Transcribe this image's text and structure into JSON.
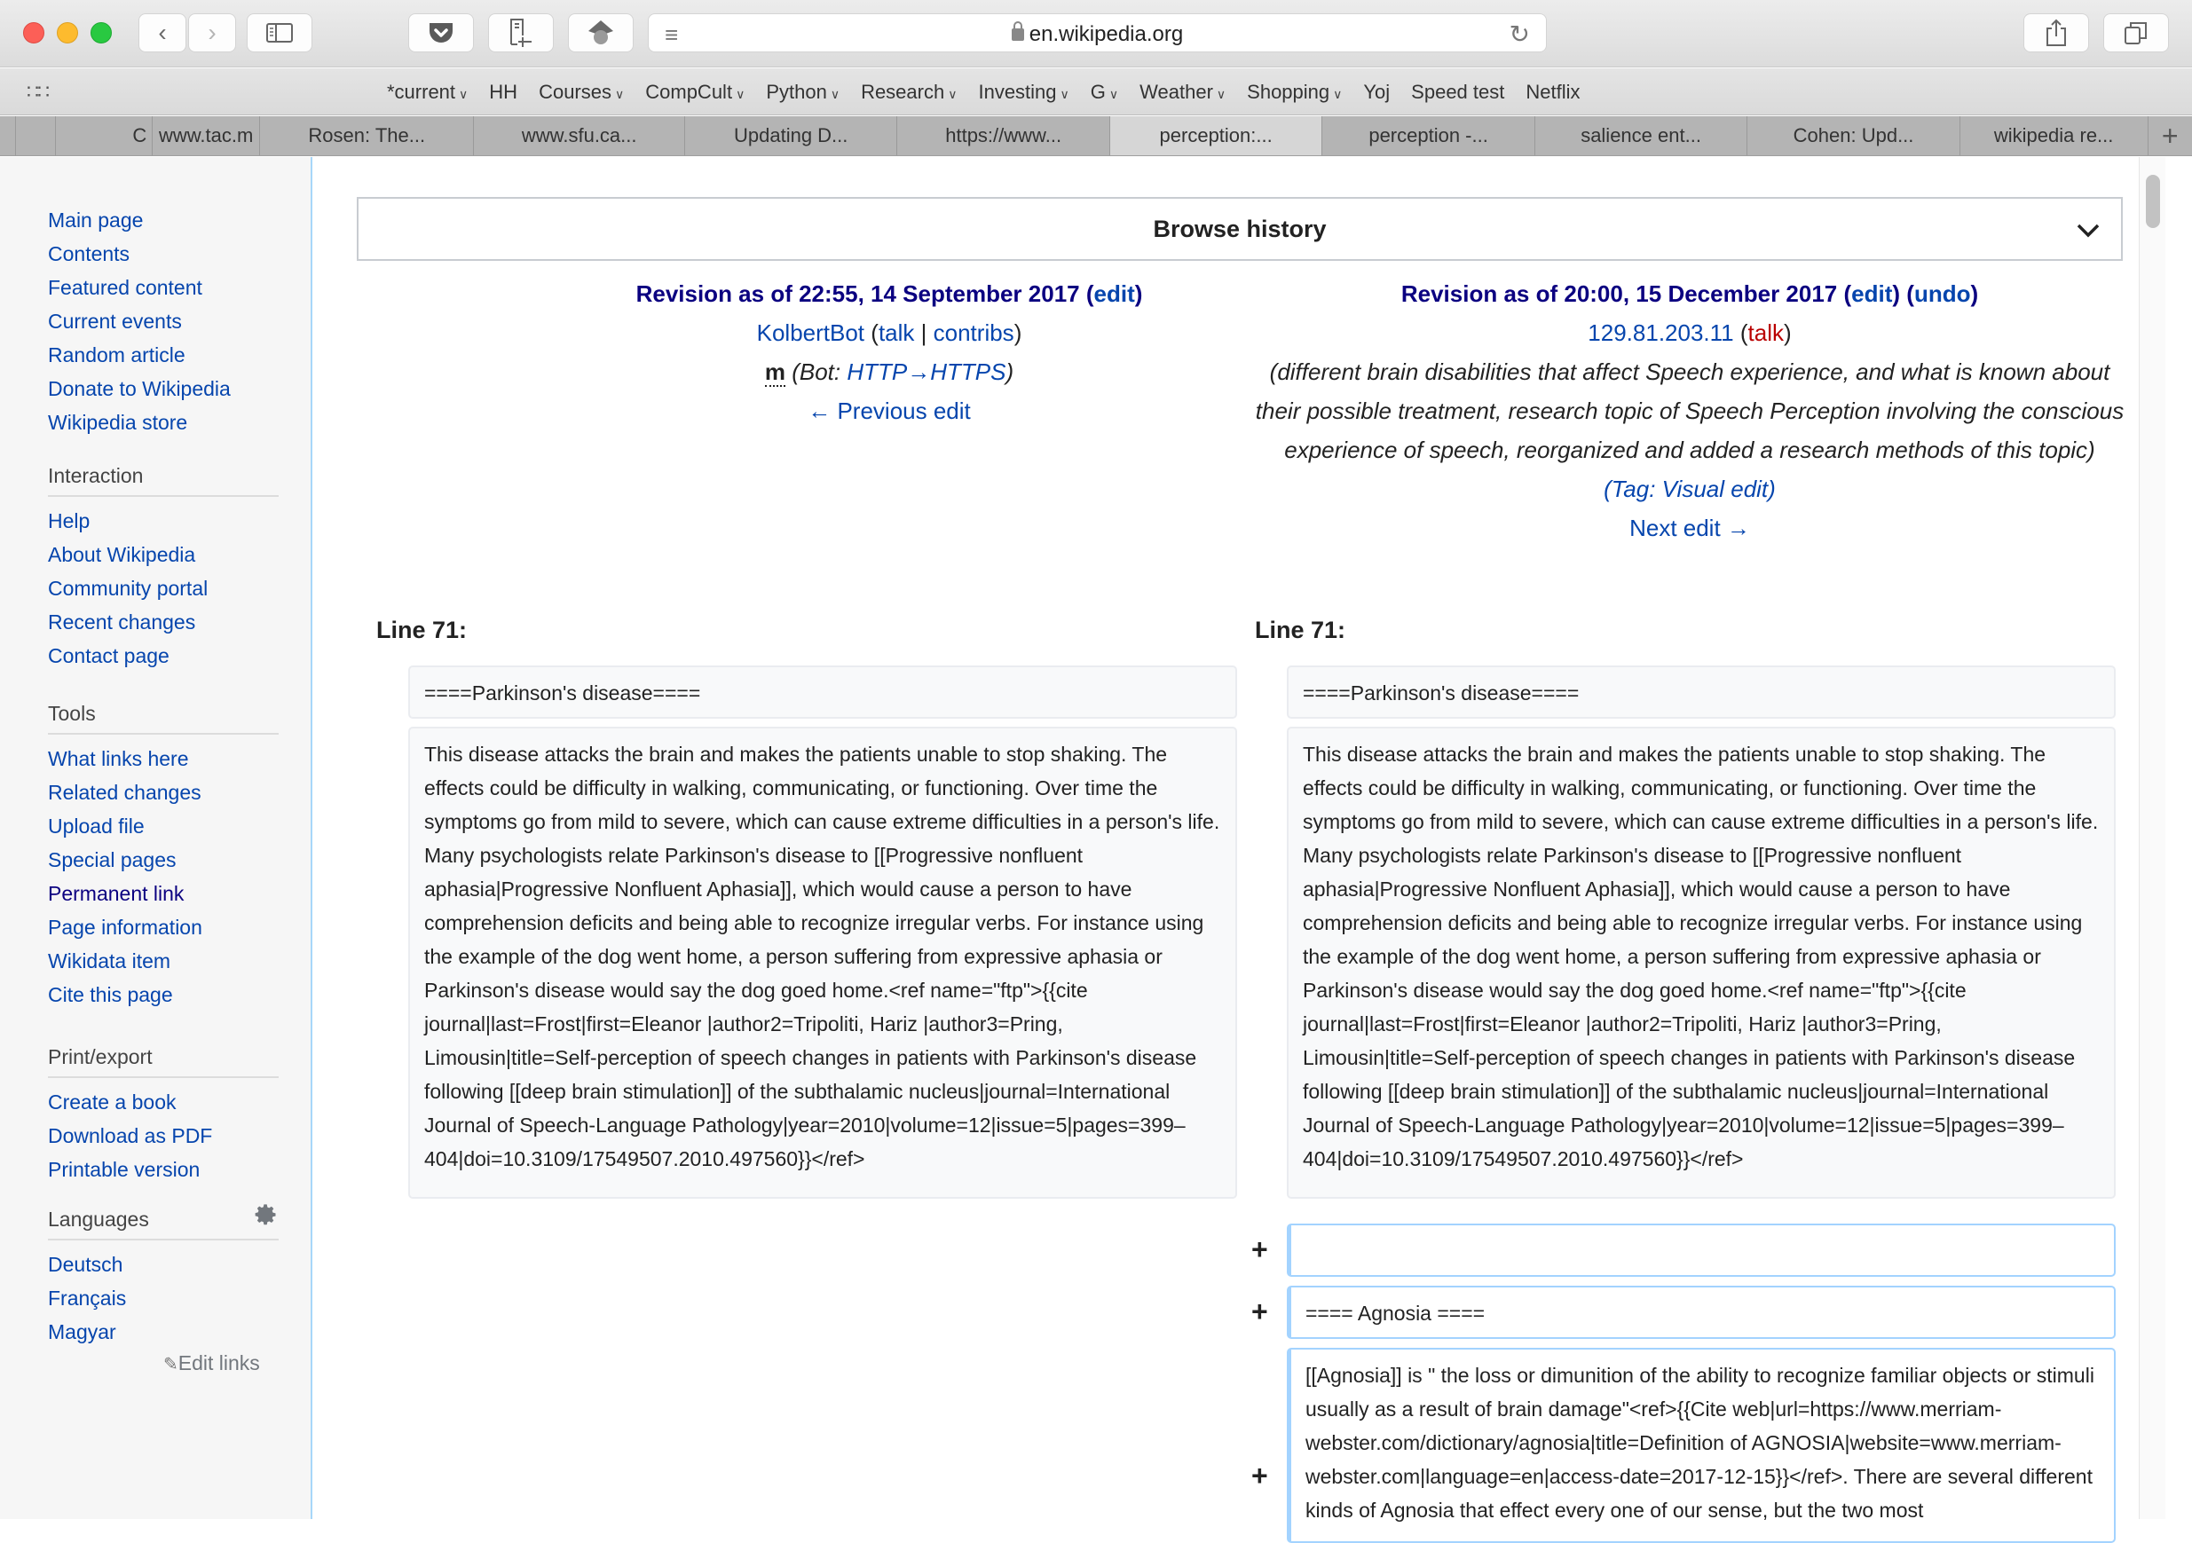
{
  "browser": {
    "url_host": "en.wikipedia.org",
    "toolbar_icons": [
      "back-icon",
      "forward-icon",
      "sidebar-icon",
      "pocket-icon",
      "add-note-icon",
      "extension-icon",
      "reader-icon",
      "reload-icon",
      "share-icon",
      "tabs-overview-icon"
    ],
    "bookmarks": [
      {
        "label": "*current",
        "dropdown": true
      },
      {
        "label": "HH",
        "dropdown": false
      },
      {
        "label": "Courses",
        "dropdown": true
      },
      {
        "label": "CompCult",
        "dropdown": true
      },
      {
        "label": "Python",
        "dropdown": true
      },
      {
        "label": "Research",
        "dropdown": true
      },
      {
        "label": "Investing",
        "dropdown": true
      },
      {
        "label": "G",
        "dropdown": true
      },
      {
        "label": "Weather",
        "dropdown": true
      },
      {
        "label": "Shopping",
        "dropdown": true
      },
      {
        "label": "Yoj",
        "dropdown": false
      },
      {
        "label": "Speed test",
        "dropdown": false
      },
      {
        "label": "Netflix",
        "dropdown": false
      }
    ],
    "tabs": [
      {
        "label": ""
      },
      {
        "label": ""
      },
      {
        "label": "C"
      },
      {
        "label": "www.tac.m"
      },
      {
        "label": "Rosen: The..."
      },
      {
        "label": "www.sfu.ca..."
      },
      {
        "label": "Updating D..."
      },
      {
        "label": "https://www..."
      },
      {
        "label": "perception:...",
        "active": true
      },
      {
        "label": "perception -..."
      },
      {
        "label": "salience ent..."
      },
      {
        "label": "Cohen: Upd..."
      },
      {
        "label": "wikipedia re..."
      }
    ],
    "new_tab_label": "+"
  },
  "sidebar": {
    "nav": [
      "Main page",
      "Contents",
      "Featured content",
      "Current events",
      "Random article",
      "Donate to Wikipedia",
      "Wikipedia store"
    ],
    "interaction": {
      "heading": "Interaction",
      "items": [
        "Help",
        "About Wikipedia",
        "Community portal",
        "Recent changes",
        "Contact page"
      ]
    },
    "tools": {
      "heading": "Tools",
      "items": [
        "What links here",
        "Related changes",
        "Upload file",
        "Special pages",
        "Permanent link",
        "Page information",
        "Wikidata item",
        "Cite this page"
      ]
    },
    "print": {
      "heading": "Print/export",
      "items": [
        "Create a book",
        "Download as PDF",
        "Printable version"
      ]
    },
    "languages": {
      "heading": "Languages",
      "items": [
        "Deutsch",
        "Français",
        "Magyar"
      ],
      "edit_links": "Edit links"
    }
  },
  "browse_history": {
    "label": "Browse history"
  },
  "left_revision": {
    "title": "Revision as of 22:55, 14 September 2017",
    "edit": "edit",
    "user": "KolbertBot",
    "talk": "talk",
    "separator": "|",
    "contribs": "contribs",
    "minor": "m",
    "summary_prefix": "(Bot: ",
    "summary_link": "HTTP→HTTPS",
    "summary_suffix": ")",
    "nav_link": "← Previous edit"
  },
  "right_revision": {
    "title": "Revision as of 20:00, 15 December 2017",
    "edit": "edit",
    "undo": "undo",
    "user": "129.81.203.11",
    "talk": "talk",
    "summary": "(different brain disabilities that affect Speech experience, and what is known about their possible treatment, research topic of Speech Perception involving the conscious experience of speech, reorganized and added a research methods of this topic)",
    "tag_prefix": "(Tag: ",
    "tag_link": "Visual edit",
    "tag_suffix": ")",
    "nav_link": "Next edit →"
  },
  "diff": {
    "left_line": "Line 71:",
    "right_line": "Line 71:",
    "context_heading": "====Parkinson's disease====",
    "context_paragraph": "This disease attacks the brain and makes the patients unable to stop shaking. The effects could be difficulty in walking, communicating, or functioning. Over time the symptoms go from mild to severe, which can cause extreme difficulties in a person's life. Many psychologists relate Parkinson's disease to [[Progressive nonfluent aphasia|Progressive Nonfluent Aphasia]], which would cause a person to have comprehension deficits and being able to recognize irregular verbs. For instance using the example of the dog went home, a person suffering from expressive aphasia or Parkinson's disease would say the dog goed home.<ref name=\"ftp\">{{cite journal|last=Frost|first=Eleanor |author2=Tripoliti, Hariz |author3=Pring, Limousin|title=Self-perception of speech changes in patients with Parkinson's disease following [[deep brain stimulation]] of the subthalamic nucleus|journal=International Journal of Speech-Language Pathology|year=2010|volume=12|issue=5|pages=399–404|doi=10.3109/17549507.2010.497560}}</ref>",
    "added_marker": "+",
    "added": [
      "",
      "==== Agnosia ====",
      "[[Agnosia]] is \" the loss or dimunition of the ability to recognize familiar objects or stimuli usually as a result of brain damage\"<ref>{{Cite web|url=https://www.merriam-webster.com/dictionary/agnosia|title=Definition of AGNOSIA|website=www.merriam-webster.com|language=en|access-date=2017-12-15}}</ref>. There are several different kinds of Agnosia that effect every one of our sense, but the two most"
    ]
  },
  "colors": {
    "link": "#0645ad",
    "visited_link": "#0b0080",
    "new_link": "#ba0000",
    "added_border": "#a3d3ff",
    "context_bg": "#f8f9fa"
  }
}
